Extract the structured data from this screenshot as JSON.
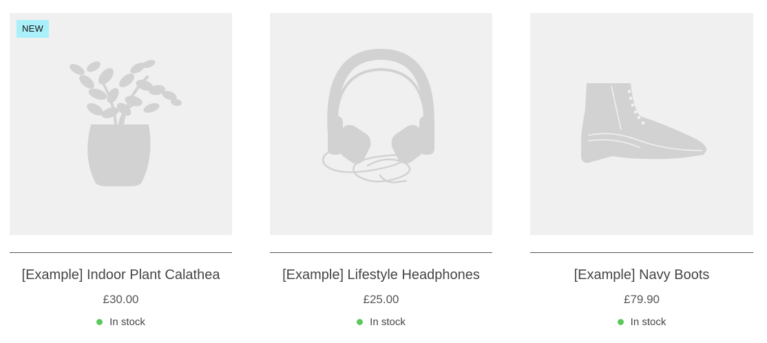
{
  "products": [
    {
      "badge": "NEW",
      "image_icon": "plant-icon",
      "title": "[Example] Indoor Plant Calathea",
      "price": "£30.00",
      "stock": "In stock"
    },
    {
      "badge": "",
      "image_icon": "headphones-icon",
      "title": "[Example] Lifestyle Headphones",
      "price": "£25.00",
      "stock": "In stock"
    },
    {
      "badge": "",
      "image_icon": "boot-icon",
      "title": "[Example] Navy Boots",
      "price": "£79.90",
      "stock": "In stock"
    }
  ],
  "colors": {
    "badge_bg": "#aaf0fb",
    "in_stock_dot": "#5cc85c",
    "image_bg": "#f0f0f0",
    "silhouette": "#d2d2d2"
  }
}
